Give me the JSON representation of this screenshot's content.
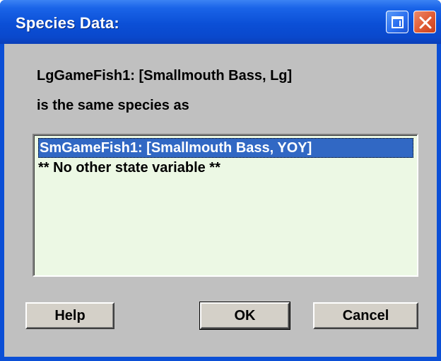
{
  "window": {
    "title": "Species Data:",
    "restore_icon": "restore-icon",
    "close_icon": "close-icon",
    "colors": {
      "titlebar": "#0b4fd6",
      "client": "#c0c0c0",
      "list_background": "#ecf8e4",
      "selection": "#3168c4"
    }
  },
  "message": {
    "line1": "LgGameFish1: [Smallmouth Bass, Lg]",
    "line2": "is the same species as"
  },
  "species_list": {
    "items": [
      {
        "label": "SmGameFish1: [Smallmouth Bass, YOY]",
        "selected": true
      },
      {
        "label": "** No other state variable **",
        "selected": false
      }
    ]
  },
  "buttons": {
    "help": "Help",
    "ok": "OK",
    "cancel": "Cancel"
  }
}
